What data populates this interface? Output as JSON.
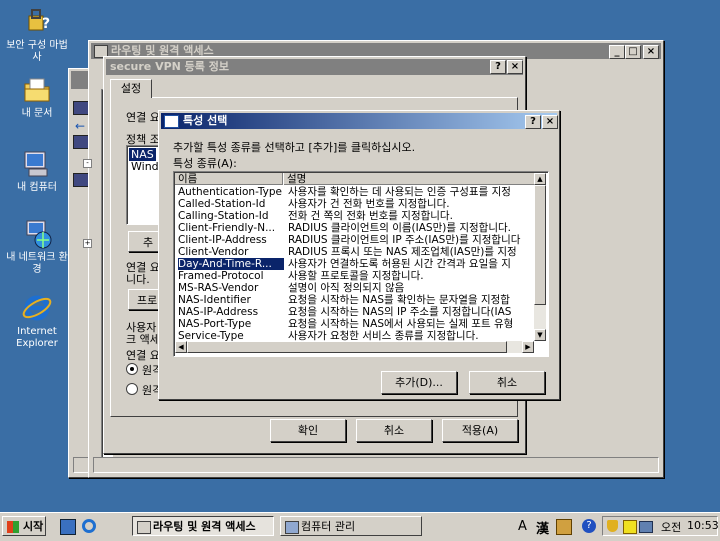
{
  "desktop_icons": [
    {
      "label": "보안 구성 마법사",
      "icon": "security-wizard-icon"
    },
    {
      "label": "내 문서",
      "icon": "my-documents-icon"
    },
    {
      "label": "내 컴퓨터",
      "icon": "my-computer-icon"
    },
    {
      "label": "내 네트워크 환경",
      "icon": "network-places-icon"
    },
    {
      "label": "Internet Explorer",
      "icon": "internet-explorer-icon"
    }
  ],
  "rras_window": {
    "title": "라우팅 및 원격 액세스"
  },
  "profile_dialog": {
    "title": "secure VPN 등록 정보",
    "tab": "설정",
    "conn_label": "연결 요",
    "policy_label": "정책 조",
    "policy_items": [
      "NAS",
      "Windo"
    ],
    "add_partial": "추",
    "text1": "연결 요",
    "text1b": "니다.",
    "profile_btn": "프로",
    "text2": "사용자",
    "text2b": "크 액세",
    "text3": "연결 요",
    "radio1": "원격",
    "radio2": "원격",
    "ok": "확인",
    "cancel": "취소",
    "apply": "적용(A)"
  },
  "attr_dialog": {
    "title": "특성 선택",
    "instructions": "추가할 특성 종류를 선택하고 [추가]를 클릭하십시오.",
    "list_label": "특성 종류(A):",
    "col_name": "이름",
    "col_desc": "설명",
    "rows": [
      {
        "name": "Authentication-Type",
        "desc": "사용자를 확인하는 데 사용되는 인증 구성표를 지정"
      },
      {
        "name": "Called-Station-Id",
        "desc": "사용자가 건 전화 번호를 지정합니다."
      },
      {
        "name": "Calling-Station-Id",
        "desc": "전화 건 쪽의 전화 번호를 지정합니다."
      },
      {
        "name": "Client-Friendly-N...",
        "desc": "RADIUS 클라이언트의 이름(IAS만)를 지정합니다."
      },
      {
        "name": "Client-IP-Address",
        "desc": "RADIUS 클라이언트의 IP 주소(IAS만)를 지정합니다"
      },
      {
        "name": "Client-Vendor",
        "desc": "RADIUS 프록시 또는 NAS 제조업체(IAS만)를 지정"
      },
      {
        "name": "Day-And-Time-R...",
        "desc": "사용자가 연결하도록 허용된 시간 간격과 요일을 지"
      },
      {
        "name": "Framed-Protocol",
        "desc": "사용할 프로토콜을 지정합니다."
      },
      {
        "name": "MS-RAS-Vendor",
        "desc": "설명이 아직 정의되지 않음"
      },
      {
        "name": "NAS-Identifier",
        "desc": "요청을 시작하는 NAS를 확인하는 문자열을 지정합"
      },
      {
        "name": "NAS-IP-Address",
        "desc": "요청을 시작하는 NAS의 IP 주소를 지정합니다(IAS"
      },
      {
        "name": "NAS-Port-Type",
        "desc": "요청을 시작하는 NAS에서 사용되는 실제 포트 유형"
      },
      {
        "name": "Service-Type",
        "desc": "사용자가 요청한 서비스 종류를 지정합니다."
      }
    ],
    "selected_index": 6,
    "add_button": "추가(D)...",
    "cancel_button": "취소"
  },
  "taskbar": {
    "start": "시작",
    "items": [
      {
        "label": "라우팅 및 원격 액세스",
        "active": true
      },
      {
        "label": "컴퓨터 관리",
        "active": false
      }
    ],
    "ime_a": "A",
    "ime_han": "漢",
    "ampm": "오전",
    "clock": "10:53"
  }
}
